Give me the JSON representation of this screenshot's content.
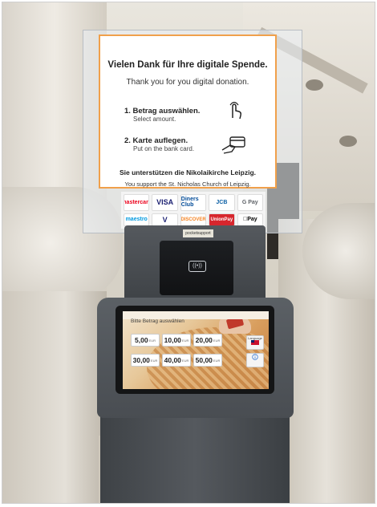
{
  "sign": {
    "title_de": "Vielen Dank für Ihre digitale Spende.",
    "title_en": "Thank you for you digital donation.",
    "steps": [
      {
        "number": "1.",
        "label_de": "Betrag auswählen.",
        "label_en": "Select amount."
      },
      {
        "number": "2.",
        "label_de": "Karte auflegen.",
        "label_en": "Put on the bank card."
      }
    ],
    "support_de": "Sie unterstützen die Nikolaikirche Leipzig.",
    "support_en": "You support the St. Nicholas Church of Leipzig."
  },
  "payment_logos": [
    "mastercard",
    "VISA",
    "Diners Club",
    "JCB",
    "G Pay",
    "maestro",
    "V",
    "DISCOVER",
    "UnionPay",
    "Pay"
  ],
  "terminal": {
    "label_strip": "pocketsupport",
    "nfc_symbol": "((•))"
  },
  "screen": {
    "header": "",
    "title": "Bitte Betrag auswählen",
    "currency": "EUR",
    "amounts": [
      "5,00",
      "10,00",
      "20,00",
      "30,00",
      "40,00",
      "50,00"
    ],
    "side_buttons": [
      {
        "label": "Language",
        "icon": "flag-icon"
      },
      {
        "label": "",
        "icon": "info-icon"
      }
    ]
  },
  "colors": {
    "sign_border": "#f0a04b",
    "kiosk_body": "#55595e",
    "screen_button": "#ffffff"
  }
}
